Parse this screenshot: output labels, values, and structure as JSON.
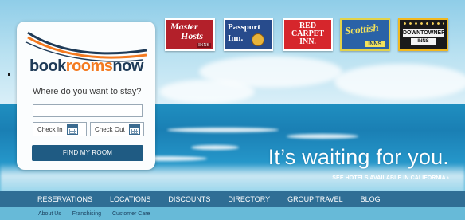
{
  "brand_logo": {
    "book": "book",
    "rooms": "rooms",
    "now": "now",
    "color_navy": "#1e3a57",
    "color_orange": "#f47a20"
  },
  "search": {
    "prompt": "Where do you want to stay?",
    "destination_value": "",
    "checkin_label": "Check In",
    "checkout_label": "Check Out",
    "find_button": "FIND MY ROOM"
  },
  "brands": [
    {
      "name_line1": "Master",
      "name_line2": "Hosts",
      "tag": "INNS"
    },
    {
      "name_line1": "Passport",
      "name_line2": "Inn."
    },
    {
      "name_line1": "RED",
      "name_line2": "CARPET",
      "name_line3": "INN."
    },
    {
      "name_line1": "Scottish",
      "tag": "INNS."
    },
    {
      "name_line1": "DOWNTOWNER",
      "tag": "INNS"
    }
  ],
  "hero": {
    "tagline": "It’s waiting for you.",
    "cta": "SEE HOTELS AVAILABLE IN CALIFORNIA ›"
  },
  "nav": {
    "items": [
      "RESERVATIONS",
      "LOCATIONS",
      "DISCOUNTS",
      "DIRECTORY",
      "GROUP TRAVEL",
      "BLOG"
    ]
  },
  "subnav": {
    "items": [
      "About Us",
      "Franchising",
      "Customer Care"
    ]
  },
  "colors": {
    "nav_bg": "#2f6e95",
    "subnav_bg": "#67bad8",
    "button_bg": "#1f5b83"
  }
}
